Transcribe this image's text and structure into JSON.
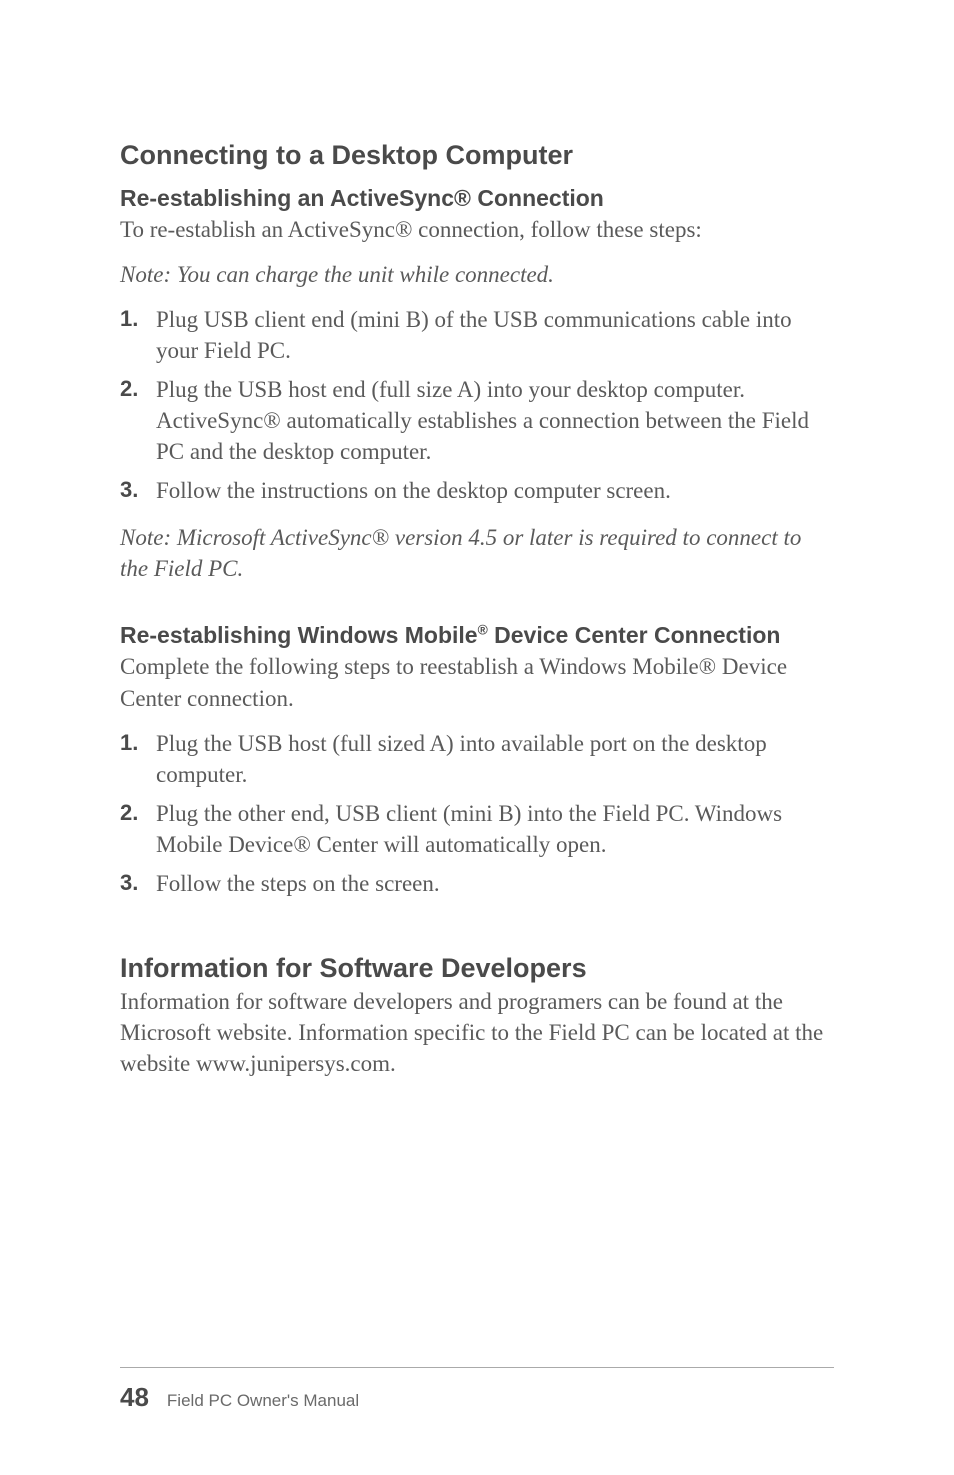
{
  "h2_connecting": "Connecting to a Desktop Computer",
  "h3_activesync": "Re-establishing an ActiveSync® Connection",
  "p_activesync_intro": "To re-establish an ActiveSync® connection, follow these steps:",
  "p_note_charge": "Note: You can charge the unit while connected.",
  "list1": {
    "n1": "1.",
    "t1": "Plug USB client end (mini B) of the USB communications cable into your Field PC.",
    "n2": "2.",
    "t2": "Plug the USB host end (full size A) into your desktop computer. ActiveSync® automatically establishes a connection between the Field PC and the desktop computer.",
    "n3": "3.",
    "t3": "Follow the instructions on the desktop computer screen."
  },
  "p_note_ms": "Note: Microsoft ActiveSync® version 4.5 or later is required to connect to the Field PC.",
  "h3_wm_pre": "Re-establishing Windows Mobile",
  "h3_wm_sup": "®",
  "h3_wm_post": " Device Center Connection",
  "p_wm_intro": "Complete the following steps to reestablish a Windows Mobile® Device Center connection.",
  "list2": {
    "n1": "1.",
    "t1": "Plug the USB host (full sized A) into available port on the desktop computer.",
    "n2": "2.",
    "t2": "Plug the other end, USB client (mini B) into the Field PC. Windows Mobile Device® Center will automatically open.",
    "n3": "3.",
    "t3": "Follow the steps on the screen."
  },
  "h2_info": "Information for Software Developers",
  "p_info": "Information for software developers and programers can be found at the Microsoft website. Information specific to the Field PC can be located at the website www.junipersys.com.",
  "footer": {
    "page": "48",
    "title": "Field PC Owner's Manual"
  }
}
